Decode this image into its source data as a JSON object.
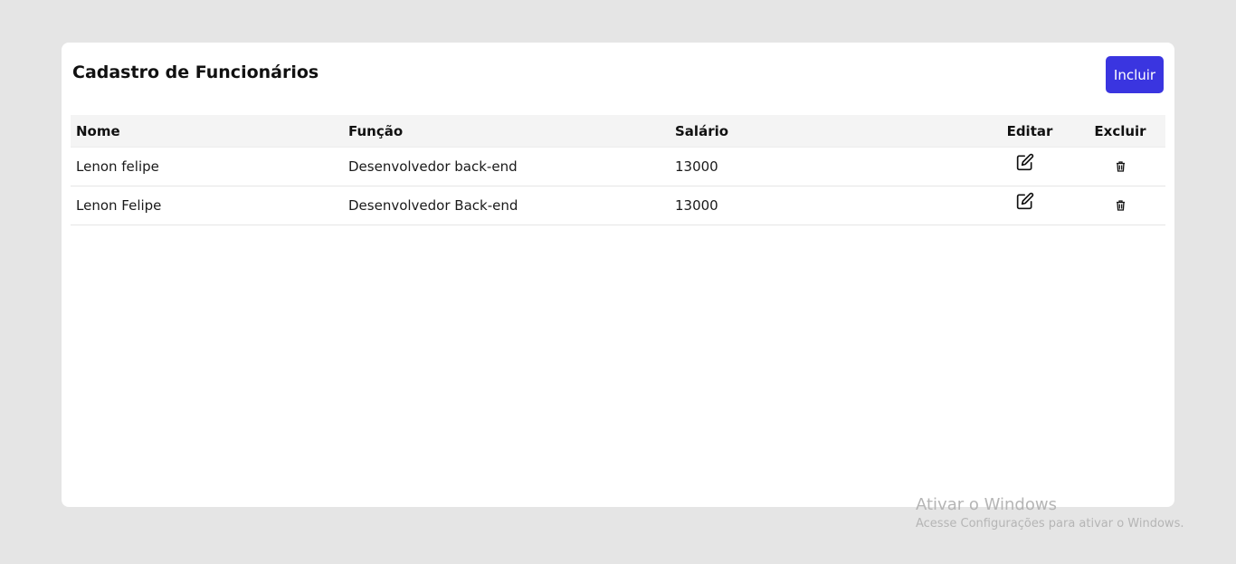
{
  "page": {
    "title": "Cadastro de Funcionários",
    "add_label": "Incluir"
  },
  "table": {
    "headers": {
      "name": "Nome",
      "role": "Função",
      "salary": "Salário",
      "edit": "Editar",
      "delete": "Excluir"
    },
    "rows": [
      {
        "name": "Lenon felipe",
        "role": "Desenvolvedor back-end",
        "salary": "13000"
      },
      {
        "name": "Lenon Felipe",
        "role": "Desenvolvedor Back-end",
        "salary": "13000"
      }
    ],
    "row_icons": {
      "edit": "edit-icon",
      "delete": "trash-icon"
    }
  },
  "watermark": {
    "title": "Ativar o Windows",
    "subtitle": "Acesse Configurações para ativar o Windows."
  },
  "colors": {
    "background": "#e5e5e5",
    "card": "#ffffff",
    "accent": "#3a35e0",
    "header_row": "#f4f4f4"
  }
}
